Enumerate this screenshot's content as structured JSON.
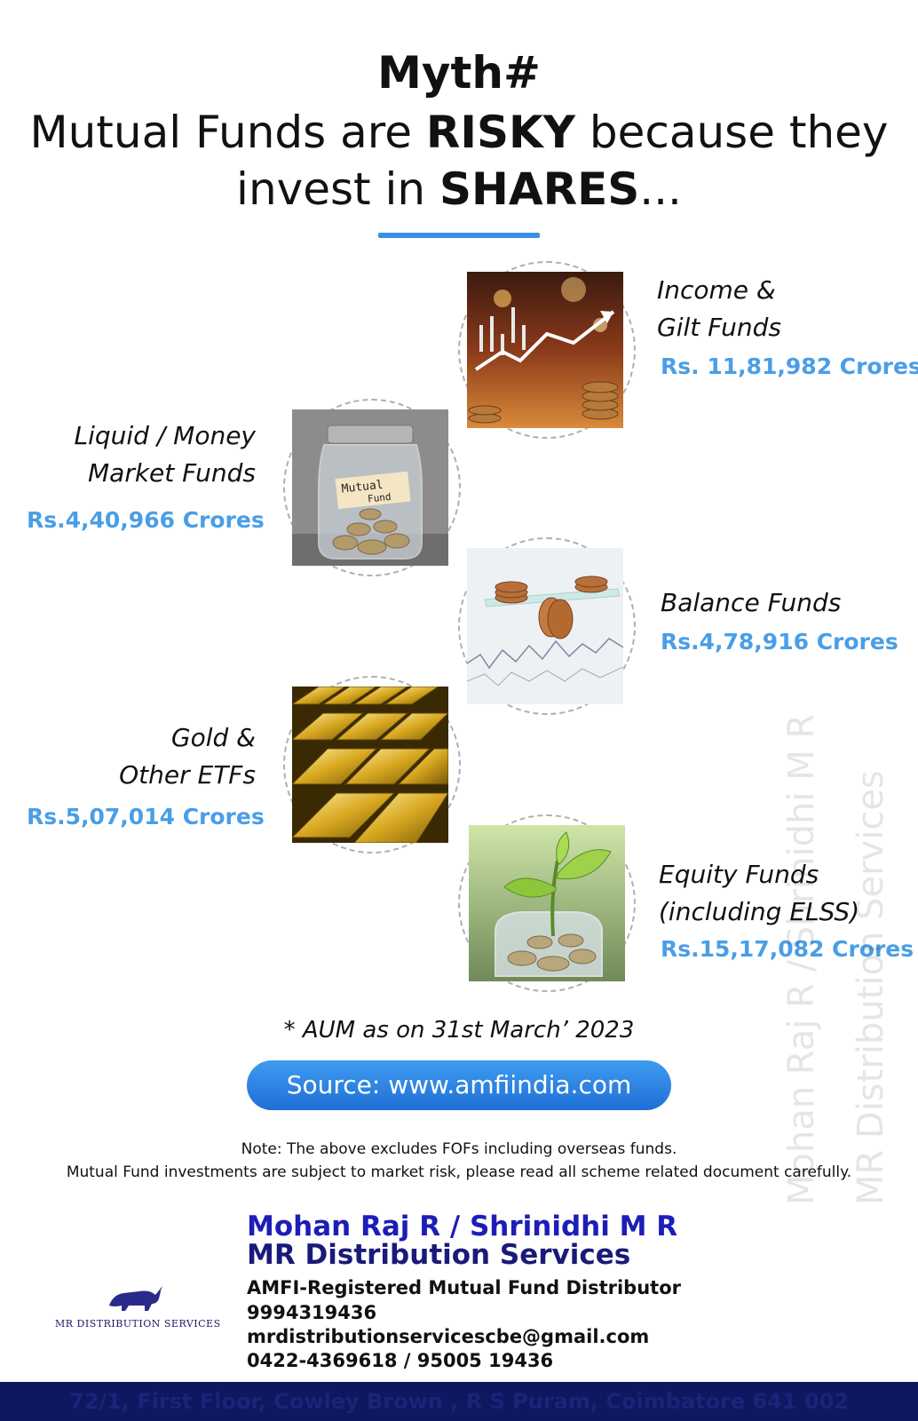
{
  "title": {
    "line1": "Myth#",
    "line2_pre": "Mutual Funds are ",
    "line2_bold": "RISKY",
    "line2_post": " because they",
    "line3_pre": "invest in ",
    "line3_bold": "SHARES",
    "line3_post": "..."
  },
  "funds": [
    {
      "name_line1": "Income &",
      "name_line2": "Gilt Funds",
      "amount": "Rs. 11,81,982 Crores",
      "image_icon": "chart-coins-icon"
    },
    {
      "name_line1": "Liquid / Money",
      "name_line2": "Market Funds",
      "amount": "Rs.4,40,966 Crores",
      "image_icon": "coin-jar-icon",
      "jar_label_line1": "Mutual",
      "jar_label_line2": "Fund"
    },
    {
      "name_line1": "Balance Funds",
      "name_line2": "",
      "amount": "Rs.4,78,916 Crores",
      "image_icon": "balanced-coins-icon"
    },
    {
      "name_line1": "Gold &",
      "name_line2": "Other ETFs",
      "amount": "Rs.5,07,014 Crores",
      "image_icon": "gold-bars-icon"
    },
    {
      "name_line1": "Equity Funds",
      "name_line2": "(including ELSS)",
      "amount": "Rs.15,17,082 Crores",
      "image_icon": "plant-coins-icon"
    }
  ],
  "aum_note": "* AUM as on 31st March’ 2023",
  "source_button": "Source: www.amfiindia.com",
  "notes": {
    "line1": "Note: The above excludes FOFs including overseas funds.",
    "line2": "Mutual Fund investments are subject to market risk, please read all scheme related document carefully."
  },
  "watermark": {
    "line1": "Mohan Raj R / Shrinidhi M R",
    "line2": "MR Distribution Services"
  },
  "business": {
    "names": "Mohan Raj R / Shrinidhi M R",
    "company": "MR Distribution Services",
    "tagline": "AMFI-Registered Mutual Fund Distributor",
    "phone": "9994319436",
    "email": "mrdistributionservicescbe@gmail.com",
    "landline": "0422-4369618 / 95005 19436",
    "logo_text": "MR  DISTRIBUTION SERVICES",
    "logo_icon": "bull-icon",
    "address": "72/1, First Floor, Cowley Brown , R S Puram, Coimbatore 641 002"
  },
  "colors": {
    "accent_blue": "#4a9ee6",
    "button_blue": "#1f6fd6",
    "name_blue": "#1d1db8",
    "footer_navy": "#0e1760"
  }
}
